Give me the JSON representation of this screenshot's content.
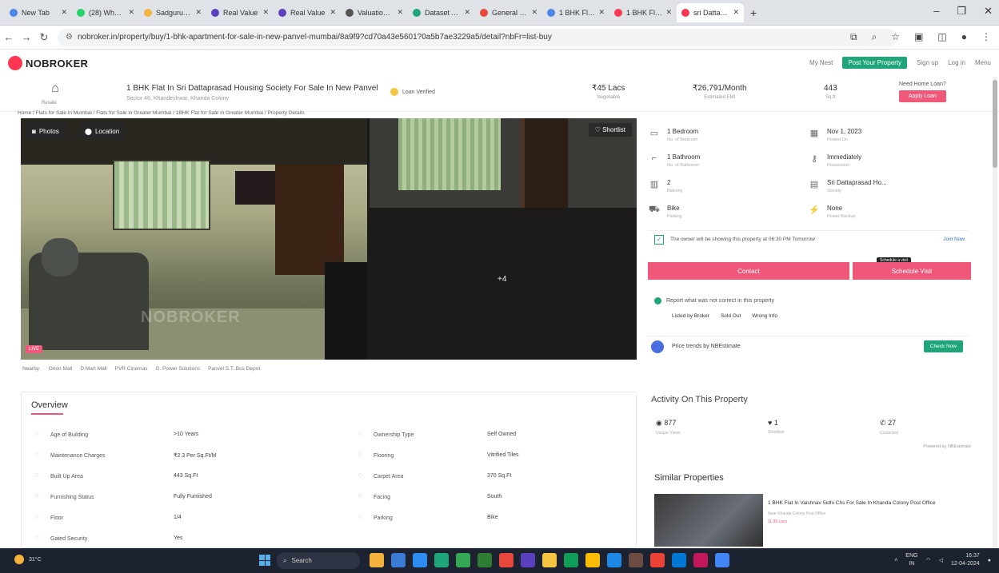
{
  "browser": {
    "tabs": [
      {
        "label": "New Tab",
        "color": "#4a87e8"
      },
      {
        "label": "(28) WhatsApp",
        "color": "#25d366"
      },
      {
        "label": "Sadguru Devel",
        "color": "#f5b23c"
      },
      {
        "label": "Real Value",
        "color": "#5a3fbf"
      },
      {
        "label": "Real Value",
        "color": "#5a3fbf"
      },
      {
        "label": "Valuation Repo",
        "color": "#555555"
      },
      {
        "label": "Dataset April",
        "color": "#1fa57a"
      },
      {
        "label": "General - Zoho",
        "color": "#e8473c"
      },
      {
        "label": "1 BHK Flat for",
        "color": "#4a87e8"
      },
      {
        "label": "1 BHK Flat, 4...",
        "color": "#fd3752"
      },
      {
        "label": "sri Dattapras",
        "color": "#fd3752"
      }
    ],
    "url": "nobroker.in/property/buy/1-bhk-apartment-for-sale-in-new-panvel-mumbai/8a9f9?cd70a43e5601?0a5b7ae3229a5/detail?nbFr=list-buy"
  },
  "header": {
    "logo": "NOBROKER",
    "links": [
      "My Nest",
      "Sign up",
      "Log in",
      "Menu"
    ],
    "post_button": "Post Your Property"
  },
  "summary": {
    "home_label": "Resale",
    "title": "1 BHK Flat In Sri Dattaprasad Housing Society For Sale In New Panvel",
    "address": "Sector 46, Khandeshwar, Khanda Colony",
    "loan_verified": "Loan Verified",
    "price": "₹45 Lacs",
    "price_label": "Negotiable",
    "emi": "₹26,791/Month",
    "emi_label": "Estimated EMI",
    "area": "443",
    "area_label": "Sq.ft",
    "loan_question": "Need Home Loan?",
    "apply_button": "Apply Loan"
  },
  "breadcrumb": "Home / Flats for Sale in Mumbai / Flats for Sale in Greater Mumbai / 1BHK Flat for Sale in Greater Mumbai / Property Details",
  "gallery": {
    "photos_button": "Photos",
    "location_button": "Location",
    "save_button": "Shortlist",
    "more_count": "+4",
    "live_badge": "LIVE",
    "watermark": "NOBROKER"
  },
  "nearby": [
    "Nearby:",
    "Orion Mall",
    "D Mart Mall",
    "PVR Cinemas",
    "G. Power Solutions",
    "Panvel S.T. Bus Depot"
  ],
  "details": [
    {
      "value": "1 Bedroom",
      "label": "No. of Bedroom",
      "icon": "bed-icon"
    },
    {
      "value": "Nov 1, 2023",
      "label": "Posted On",
      "icon": "calendar-icon"
    },
    {
      "value": "1 Bathroom",
      "label": "No. of Bathroom",
      "icon": "bath-icon"
    },
    {
      "value": "Immediately",
      "label": "Possession",
      "icon": "key-icon"
    },
    {
      "value": "2",
      "label": "Balcony",
      "icon": "balcony-icon"
    },
    {
      "value": "Sri Dattaprasad Ho...",
      "label": "Society",
      "icon": "building-icon"
    },
    {
      "value": "Bike",
      "label": "Parking",
      "icon": "vehicle-icon"
    },
    {
      "value": "None",
      "label": "Power Backup",
      "icon": "power-icon"
    }
  ],
  "owner_notice": "The owner will be showing this property at 06:30 PM Tomorrow",
  "owner_link": "Join Now",
  "contact_button": "Contact",
  "visit_button": "Schedule Visit",
  "visit_tooltip": "Schedule a visit",
  "report_text": "Report what was not correct in this property",
  "report_links": [
    "Listed by Broker",
    "Sold Out",
    "Wrong Info"
  ],
  "estimate_text": "Price trends by NBEstimate",
  "check_button": "Check Now",
  "overview": {
    "title": "Overview",
    "rows": [
      {
        "label": "Age of Building",
        "value": ">10 Years",
        "icon": "building-age-icon"
      },
      {
        "label": "Maintenance Charges",
        "value": "₹2.3 Per Sq.Ft/M",
        "icon": "maintenance-icon"
      },
      {
        "label": "Built Up Area",
        "value": "443 Sq.Ft",
        "icon": "area-icon"
      },
      {
        "label": "Furnishing Status",
        "value": "Fully Furnished",
        "icon": "sofa-icon"
      },
      {
        "label": "Floor",
        "value": "1/4",
        "icon": "floor-icon"
      },
      {
        "label": "Gated Security",
        "value": "Yes",
        "icon": "security-icon"
      },
      {
        "label": "Ownership Type",
        "value": "Self Owned",
        "icon": "ownership-icon"
      },
      {
        "label": "Flooring",
        "value": "Vitrified Tiles",
        "icon": "flooring-icon"
      },
      {
        "label": "Carpet Area",
        "value": "370 Sq.Ft",
        "icon": "carpet-icon"
      },
      {
        "label": "Facing",
        "value": "South",
        "icon": "compass-icon"
      },
      {
        "label": "Parking",
        "value": "Bike",
        "icon": "parking-icon"
      }
    ]
  },
  "activity": {
    "title": "Activity On This Property",
    "stats": [
      {
        "value": "877",
        "label": "Unique Views",
        "icon": "eye-icon"
      },
      {
        "value": "1",
        "label": "Shortlists",
        "icon": "heart-icon"
      },
      {
        "value": "27",
        "label": "Contacted",
        "icon": "phone-icon"
      }
    ],
    "note": "Powered by NBEstimate"
  },
  "similar": {
    "title": "Similar Properties",
    "card_title": "1 BHK Flat In Vaishnav Sidhi Chs For Sale In Khanda Colony Post Office",
    "card_sub": "Near Khanda Colony Post Office",
    "card_price": "11.99 Lacs"
  },
  "taskbar": {
    "weather": "31°C",
    "search_placeholder": "Search",
    "lang": "ENG",
    "region": "IN",
    "time": "16:37",
    "date": "12-04-2024"
  }
}
